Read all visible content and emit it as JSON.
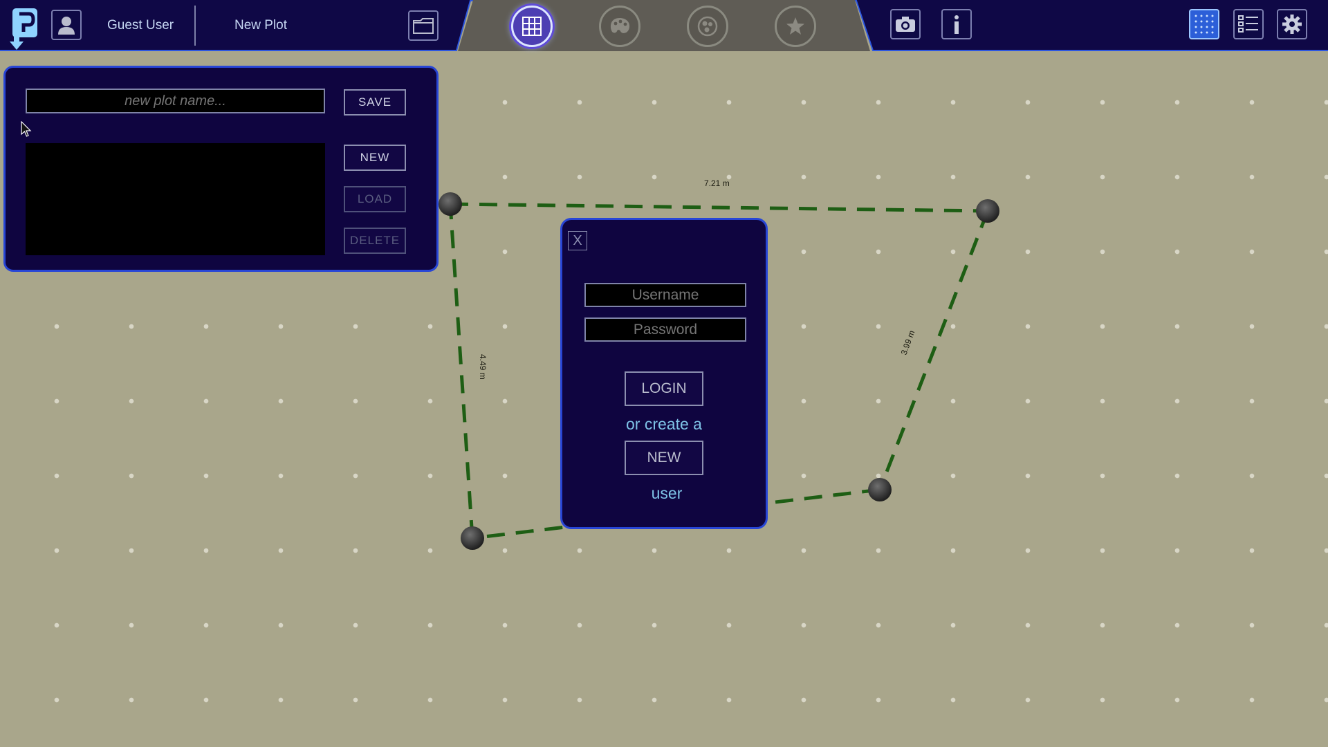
{
  "header": {
    "user_name": "Guest User",
    "plot_name": "New Plot",
    "icons": {
      "logo": "logo-icon",
      "profile": "user-icon",
      "folder": "folder-icon",
      "camera": "camera-icon",
      "info": "info-icon",
      "grid_view": "grid-icon",
      "list_view": "list-icon",
      "settings": "gear-icon"
    },
    "modes": [
      {
        "name": "grid-mode",
        "active": true
      },
      {
        "name": "palette-mode",
        "active": false
      },
      {
        "name": "plants-mode",
        "active": false
      },
      {
        "name": "favorites-mode",
        "active": false
      }
    ]
  },
  "plot_panel": {
    "name_placeholder": "new plot name...",
    "save_label": "SAVE",
    "new_label": "NEW",
    "load_label": "LOAD",
    "delete_label": "DELETE"
  },
  "plot_measurements": {
    "top": "7.21 m",
    "left": "4.49 m",
    "right": "3.99 m"
  },
  "login_dialog": {
    "close_label": "X",
    "username_placeholder": "Username",
    "password_placeholder": "Password",
    "login_label": "LOGIN",
    "or_create_text": "or create a",
    "new_label": "NEW",
    "user_text": "user"
  },
  "colors": {
    "boundary_line": "#1e5e14",
    "panel_bg": "#0f0540",
    "panel_border": "#2846d6",
    "canvas_bg": "#a9a68b"
  }
}
